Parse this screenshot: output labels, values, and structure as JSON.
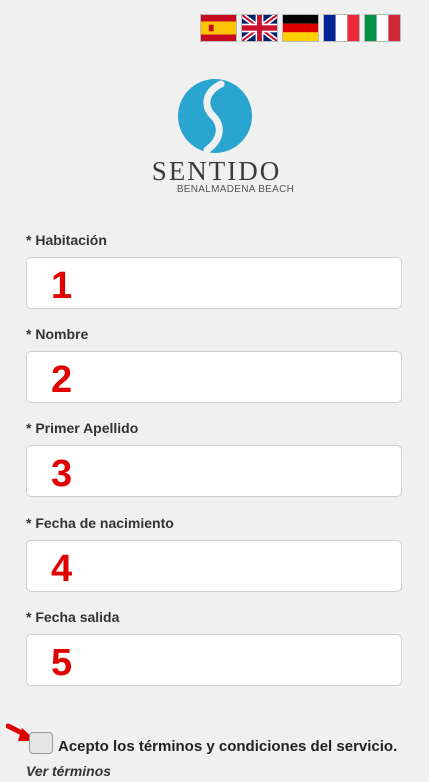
{
  "languages": [
    {
      "name": "flag-es-icon"
    },
    {
      "name": "flag-uk-icon"
    },
    {
      "name": "flag-de-icon"
    },
    {
      "name": "flag-fr-icon"
    },
    {
      "name": "flag-it-icon"
    }
  ],
  "logo": {
    "name": "SENTIDO",
    "subtitle": "BENALMADENA BEACH",
    "color": "#2aa5cf"
  },
  "form": {
    "fields": [
      {
        "label": "* Habitación",
        "value": "",
        "number": "1"
      },
      {
        "label": "* Nombre",
        "value": "",
        "number": "2"
      },
      {
        "label": "* Primer Apellido",
        "value": "",
        "number": "3"
      },
      {
        "label": "* Fecha de nacimiento",
        "value": "",
        "number": "4"
      },
      {
        "label": "* Fecha salida",
        "value": "",
        "number": "5"
      }
    ],
    "accept_label": "Acepto los términos y condiciones del servicio.",
    "terms_link": "Ver términos",
    "accept_checked": false
  },
  "colors": {
    "annotation_red": "#e00000",
    "background": "#f0f0f0"
  }
}
